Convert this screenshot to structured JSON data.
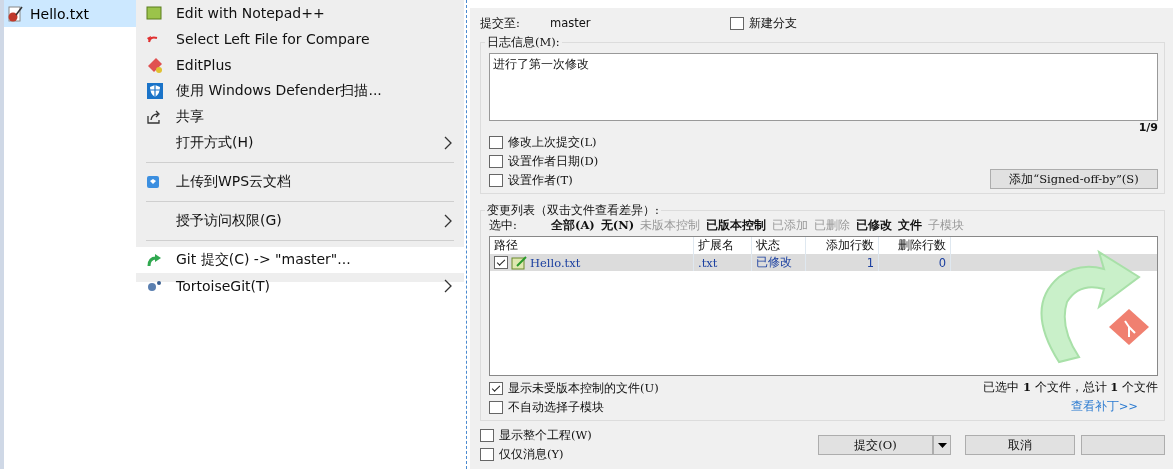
{
  "explorer": {
    "file": {
      "name": "Hello.txt",
      "selected": true
    }
  },
  "context_menu": {
    "items": [
      {
        "kind": "item",
        "label": "Edit with Notepad++",
        "submenu": false,
        "selected": false
      },
      {
        "kind": "item",
        "label": "Select Left File for Compare",
        "submenu": false,
        "selected": false
      },
      {
        "kind": "item",
        "label": "EditPlus",
        "submenu": false,
        "selected": false
      },
      {
        "kind": "item",
        "label": "使用 Windows Defender扫描...",
        "submenu": false,
        "selected": false
      },
      {
        "kind": "item",
        "label": "共享",
        "submenu": false,
        "selected": false
      },
      {
        "kind": "item",
        "label": "打开方式(H)",
        "submenu": true,
        "selected": false
      },
      {
        "kind": "separator"
      },
      {
        "kind": "item",
        "label": "上传到WPS云文档",
        "submenu": false,
        "selected": false
      },
      {
        "kind": "separator"
      },
      {
        "kind": "item",
        "label": "授予访问权限(G)",
        "submenu": true,
        "selected": false
      },
      {
        "kind": "separator"
      },
      {
        "kind": "item",
        "label": "Git 提交(C) -> \"master\"...",
        "submenu": false,
        "selected": true
      },
      {
        "kind": "item",
        "label": "TortoiseGit(T)",
        "submenu": true,
        "selected": false
      }
    ]
  },
  "commit_dialog": {
    "commit_to": {
      "label": "提交至:",
      "branch": "master"
    },
    "new_branch": {
      "label": "新建分支",
      "checked": false
    },
    "message": {
      "legend": "日志信息(M):",
      "value": "进行了第一次修改",
      "counter": "1/9"
    },
    "message_options": [
      {
        "label": "修改上次提交(L)",
        "checked": false
      },
      {
        "label": "设置作者日期(D)",
        "checked": false
      },
      {
        "label": "设置作者(T)",
        "checked": false
      }
    ],
    "signoff_button": "添加“Signed-off-by”(S)",
    "changes": {
      "legend": "变更列表（双击文件查看差异）:",
      "select_label": "选中:",
      "filters": [
        {
          "label": "全部(A)",
          "active": true
        },
        {
          "label": "无(N)",
          "active": true
        },
        {
          "label": "未版本控制",
          "active": false
        },
        {
          "label": "已版本控制",
          "active": true
        },
        {
          "label": "已添加",
          "active": false
        },
        {
          "label": "已删除",
          "active": false
        },
        {
          "label": "已修改",
          "active": true
        },
        {
          "label": "文件",
          "active": true
        },
        {
          "label": "子模块",
          "active": false
        }
      ],
      "columns": [
        "路径",
        "扩展名",
        "状态",
        "添加行数",
        "删除行数"
      ],
      "rows": [
        {
          "checked": true,
          "selected": true,
          "path": "Hello.txt",
          "extension": ".txt",
          "status": "已修改",
          "added": "1",
          "deleted": "0"
        }
      ],
      "options": [
        {
          "label": "显示未受版本控制的文件(U)",
          "checked": true
        },
        {
          "label": "不自动选择子模块",
          "checked": false
        }
      ],
      "summary": "已选中 **1** 个文件，总计 **1** 个文件",
      "patch_link": "查看补丁>>"
    },
    "bottom_options": [
      {
        "label": "显示整个工程(W)",
        "checked": false
      },
      {
        "label": "仅仅消息(Y)",
        "checked": false
      }
    ],
    "buttons": {
      "commit": "提交(O)",
      "cancel": "取消"
    }
  }
}
